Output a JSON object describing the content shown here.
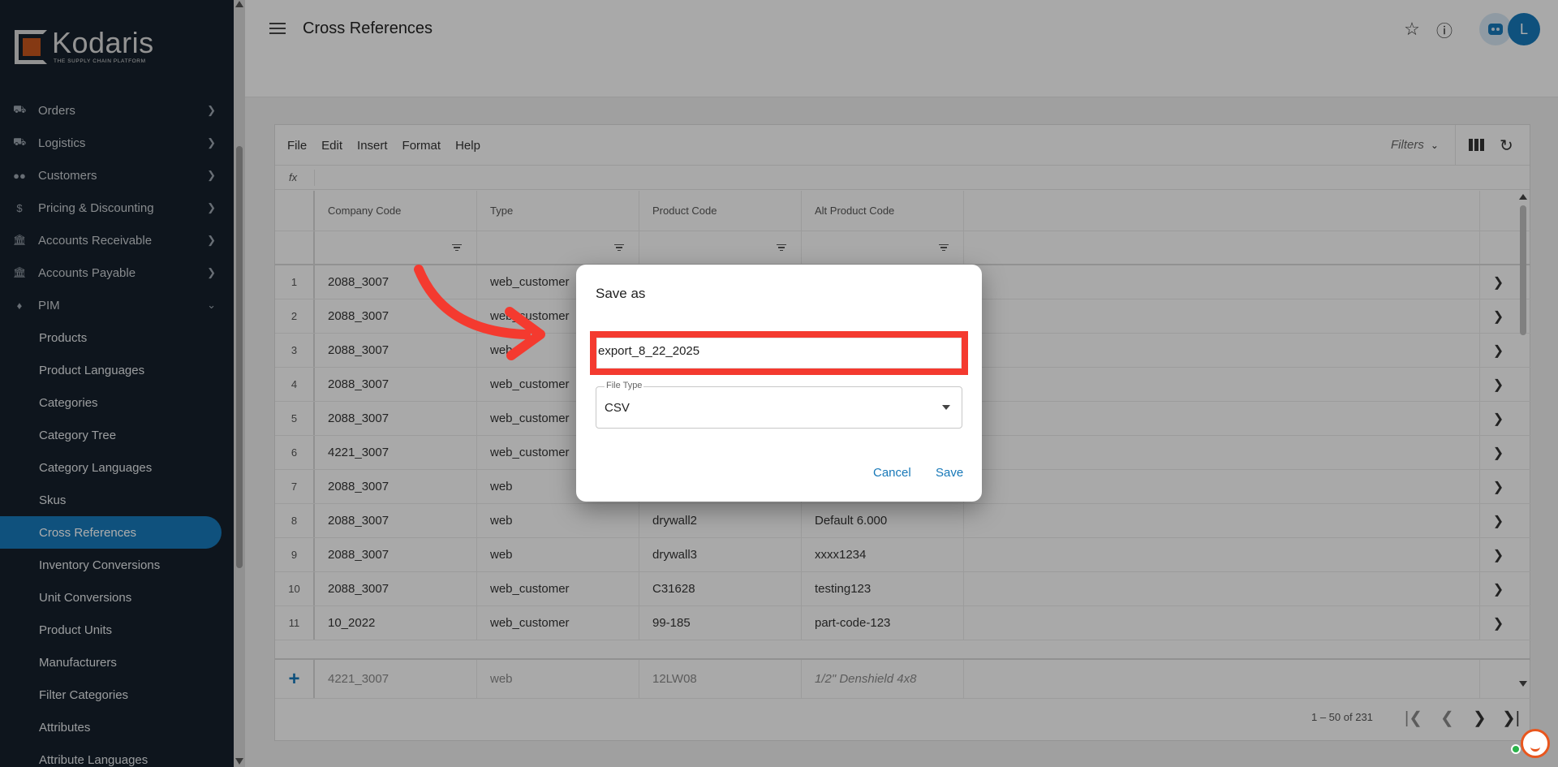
{
  "app": {
    "logo_name": "Kodaris",
    "logo_tagline": "THE SUPPLY CHAIN PLATFORM"
  },
  "sidebar": {
    "sections": [
      {
        "label": "Orders",
        "icon": "truck-icon"
      },
      {
        "label": "Logistics",
        "icon": "logistics-truck-icon"
      },
      {
        "label": "Customers",
        "icon": "people-icon"
      },
      {
        "label": "Pricing & Discounting",
        "icon": "dollar-icon"
      },
      {
        "label": "Accounts Receivable",
        "icon": "bank-icon"
      },
      {
        "label": "Accounts Payable",
        "icon": "bank-icon"
      },
      {
        "label": "PIM",
        "icon": "tag-icon"
      }
    ],
    "pim_items": [
      {
        "label": "Products"
      },
      {
        "label": "Product Languages"
      },
      {
        "label": "Categories"
      },
      {
        "label": "Category Tree"
      },
      {
        "label": "Category Languages"
      },
      {
        "label": "Skus"
      },
      {
        "label": "Cross References",
        "active": true
      },
      {
        "label": "Inventory Conversions"
      },
      {
        "label": "Unit Conversions"
      },
      {
        "label": "Product Units"
      },
      {
        "label": "Manufacturers"
      },
      {
        "label": "Filter Categories"
      },
      {
        "label": "Attributes"
      },
      {
        "label": "Attribute Languages"
      }
    ]
  },
  "header": {
    "title": "Cross References",
    "avatar_initial": "L"
  },
  "toolbar": {
    "menu": [
      "File",
      "Edit",
      "Insert",
      "Format",
      "Help"
    ],
    "filters_label": "Filters",
    "fx_label": "fx"
  },
  "grid": {
    "columns": [
      "Company Code",
      "Type",
      "Product Code",
      "Alt Product Code"
    ],
    "rows": [
      {
        "n": "1",
        "company": "2088_3007",
        "type": "web_customer",
        "product": "",
        "alt": ""
      },
      {
        "n": "2",
        "company": "2088_3007",
        "type": "web_customer",
        "product": "",
        "alt": ""
      },
      {
        "n": "3",
        "company": "2088_3007",
        "type": "web",
        "product": "",
        "alt": ""
      },
      {
        "n": "4",
        "company": "2088_3007",
        "type": "web_customer",
        "product": "",
        "alt": ""
      },
      {
        "n": "5",
        "company": "2088_3007",
        "type": "web_customer",
        "product": "",
        "alt": ""
      },
      {
        "n": "6",
        "company": "4221_3007",
        "type": "web_customer",
        "product": "",
        "alt": ""
      },
      {
        "n": "7",
        "company": "2088_3007",
        "type": "web",
        "product": "",
        "alt": ""
      },
      {
        "n": "8",
        "company": "2088_3007",
        "type": "web",
        "product": "drywall2",
        "alt": "Default 6.000"
      },
      {
        "n": "9",
        "company": "2088_3007",
        "type": "web",
        "product": "drywall3",
        "alt": "xxxx1234"
      },
      {
        "n": "10",
        "company": "2088_3007",
        "type": "web_customer",
        "product": "C31628",
        "alt": "testing123"
      },
      {
        "n": "11",
        "company": "10_2022",
        "type": "web_customer",
        "product": "99-185",
        "alt": "part-code-123"
      }
    ],
    "new_row": {
      "company": "4221_3007",
      "type": "web",
      "product": "12LW08",
      "alt": "1/2\" Denshield 4x8"
    },
    "pagination": "1 – 50 of 231"
  },
  "dialog": {
    "title": "Save as",
    "filename_value": "export_8_22_2025",
    "filetype_label": "File Type",
    "filetype_value": "CSV",
    "cancel_label": "Cancel",
    "save_label": "Save"
  },
  "colors": {
    "sidebar_bg": "#15202b",
    "accent": "#1778b8",
    "highlight": "#f43a2f"
  }
}
